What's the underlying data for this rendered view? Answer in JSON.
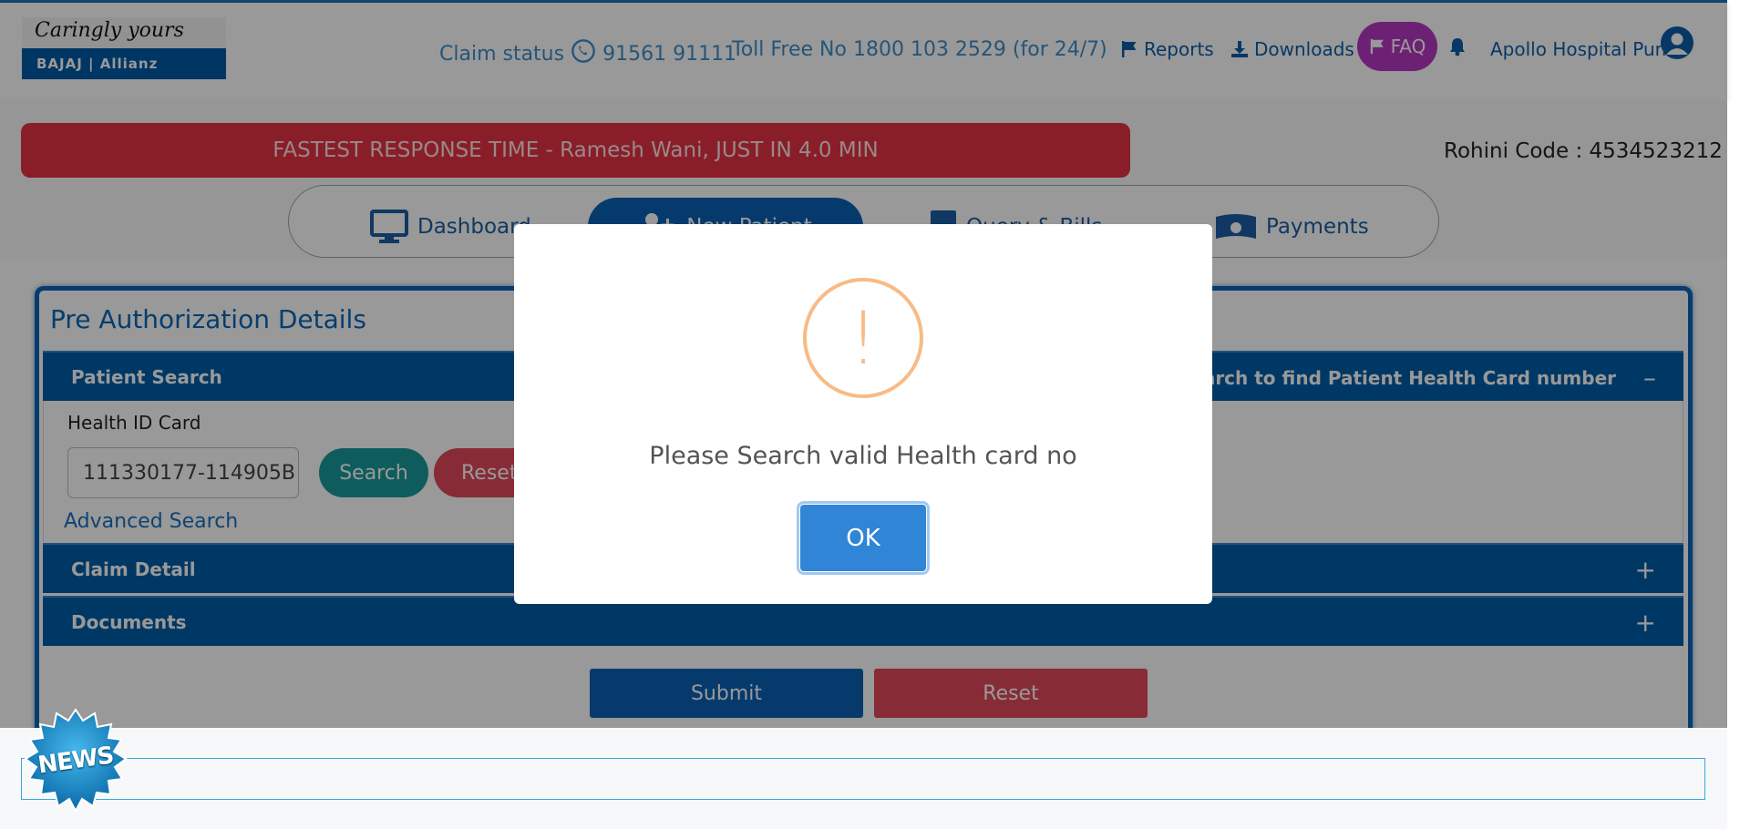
{
  "header": {
    "logo_tagline": "Caringly yours",
    "logo_brand": "BAJAJ | Allianz",
    "claim_status_label": "Claim status",
    "claim_status_phone": "91561 91111",
    "toll_free": "Toll Free No 1800 103 2529 (for 24/7)",
    "links": {
      "reports": "Reports",
      "downloads": "Downloads",
      "faq": "FAQ"
    },
    "user_name": "Apollo Hospital Pune"
  },
  "banner": {
    "text": "FASTEST RESPONSE TIME - Ramesh Wani, JUST IN 4.0 MIN"
  },
  "rohini": "Rohini Code : 4534523212",
  "nav": {
    "dashboard": "Dashboard",
    "new_patient": "New Patient",
    "query_bills": "Query & Bills",
    "payments": "Payments"
  },
  "panel": {
    "title": "Pre Authorization Details",
    "patient_search": {
      "title": "Patient Search",
      "hint": "ce search to find Patient Health Card number",
      "toggle": "–",
      "health_id_label": "Health ID Card",
      "health_id_value": "111330177-114905B",
      "search_button": "Search",
      "reset_button": "Reset",
      "advanced_search": "Advanced Search"
    },
    "claim_detail": {
      "title": "Claim Detail",
      "toggle": "+"
    },
    "documents": {
      "title": "Documents",
      "toggle": "+"
    },
    "submit_button": "Submit",
    "reset_button": "Reset"
  },
  "news": {
    "badge": "NEWS"
  },
  "modal": {
    "icon": "!",
    "message": "Please Search valid Health card no",
    "ok_button": "OK"
  },
  "colors": {
    "primary": "#005ea8",
    "danger": "#e63344",
    "faq": "#b638c1",
    "teal": "#1a9a9c",
    "warning": "#f8bb86",
    "ok": "#3085d6"
  }
}
